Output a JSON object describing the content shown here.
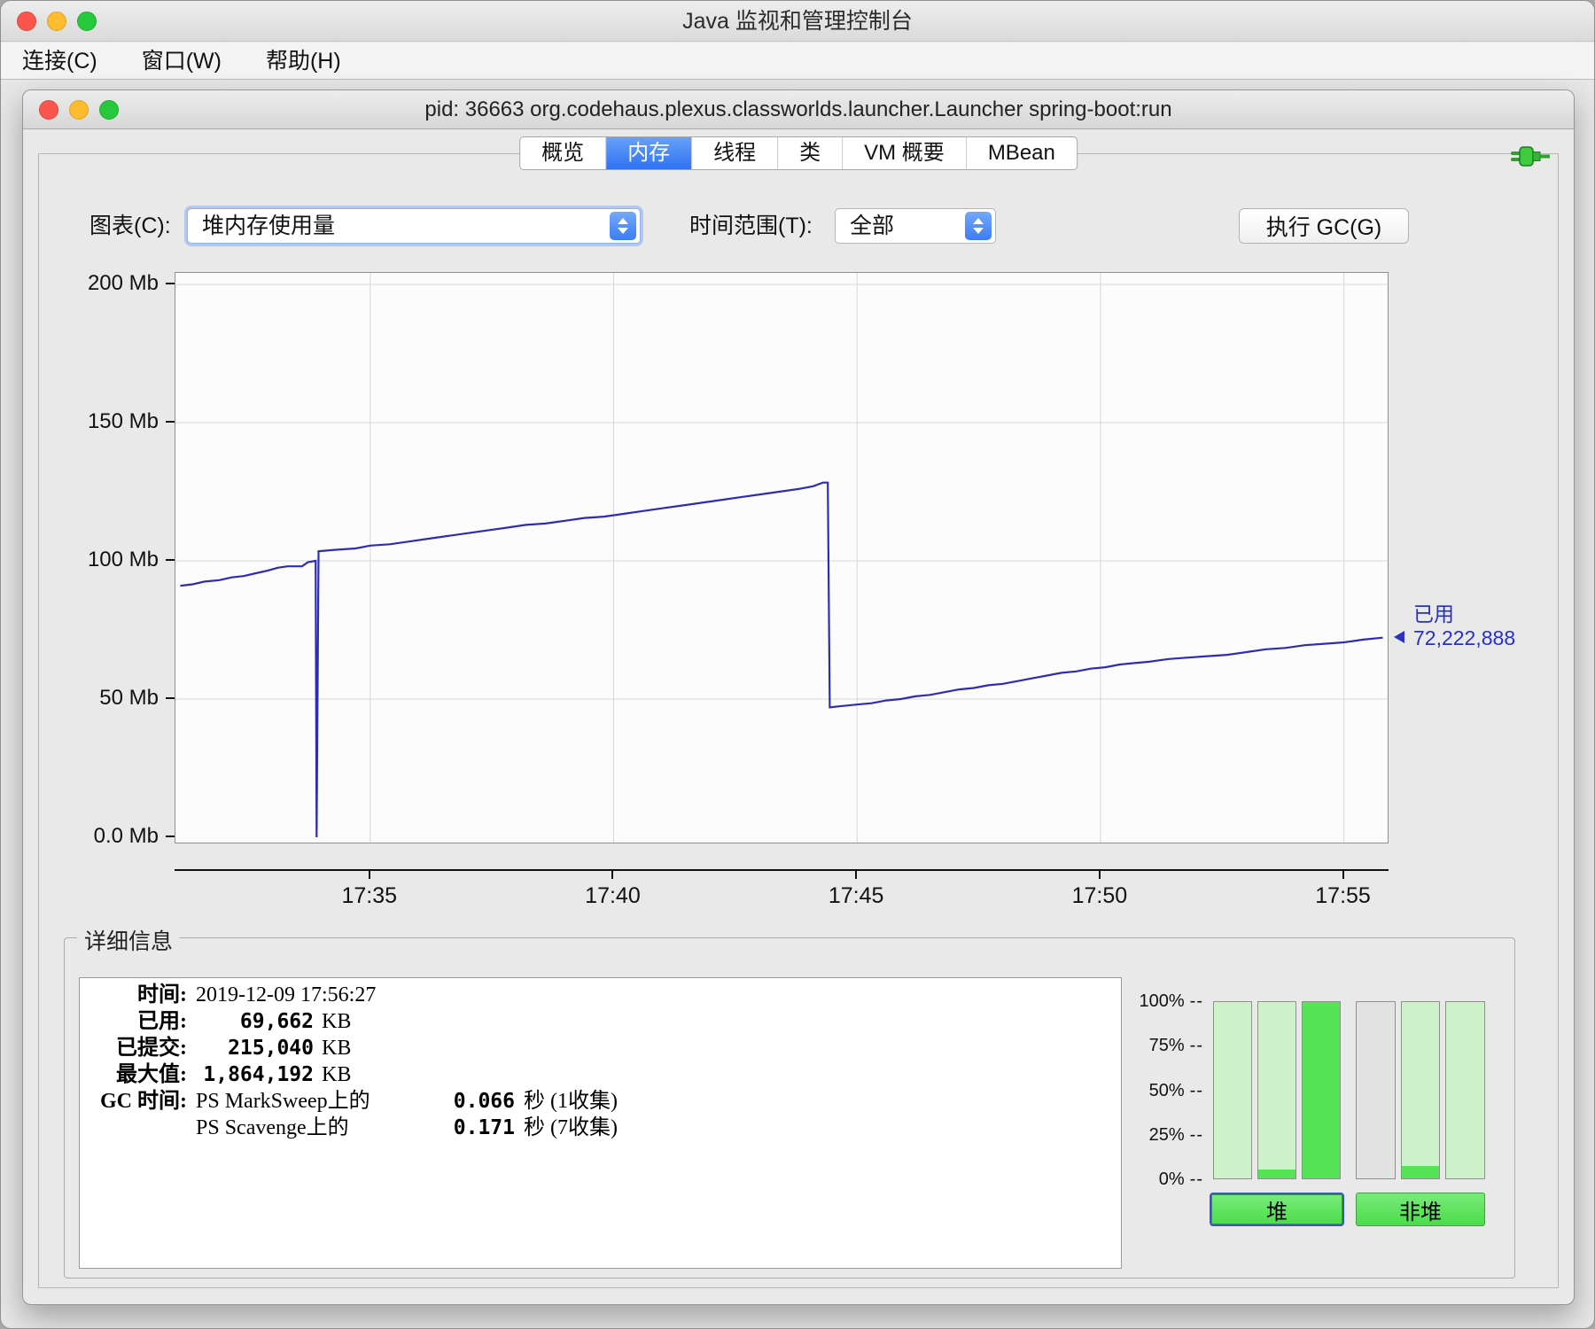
{
  "window": {
    "title": "Java 监视和管理控制台",
    "menu": [
      {
        "label": "连接(C)"
      },
      {
        "label": "窗口(W)"
      },
      {
        "label": "帮助(H)"
      }
    ]
  },
  "inner": {
    "title": "pid: 36663 org.codehaus.plexus.classworlds.launcher.Launcher spring-boot:run",
    "tabs": [
      {
        "label": "概览",
        "selected": false
      },
      {
        "label": "内存",
        "selected": true
      },
      {
        "label": "线程",
        "selected": false
      },
      {
        "label": "类",
        "selected": false
      },
      {
        "label": "VM 概要",
        "selected": false
      },
      {
        "label": "MBean",
        "selected": false
      }
    ]
  },
  "controls": {
    "chart_label": "图表(C):",
    "chart_value": "堆内存使用量",
    "range_label": "时间范围(T):",
    "range_value": "全部",
    "gc_button": "执行 GC(G)"
  },
  "chart_data": {
    "type": "line",
    "title": "堆内存使用量",
    "ylabel": "Mb",
    "ylim": [
      0,
      200
    ],
    "xlim": [
      0,
      24.9
    ],
    "x_unit": "minutes_since_17:31",
    "grid": true,
    "line_color": "#2d2db4",
    "y_ticks": [
      {
        "v": 0,
        "label": "0.0 Mb"
      },
      {
        "v": 50,
        "label": "50 Mb"
      },
      {
        "v": 100,
        "label": "100 Mb"
      },
      {
        "v": 150,
        "label": "150 Mb"
      },
      {
        "v": 200,
        "label": "200 Mb"
      }
    ],
    "x_ticks": [
      {
        "t": 4,
        "label": "17:35"
      },
      {
        "t": 9,
        "label": "17:40"
      },
      {
        "t": 14,
        "label": "17:45"
      },
      {
        "t": 19,
        "label": "17:50"
      },
      {
        "t": 24,
        "label": "17:55"
      }
    ],
    "annotation": {
      "label": "已用",
      "value": "72,222,888",
      "at_mb": 72.2
    },
    "series": [
      {
        "name": "已用堆内存 (Mb)",
        "points": [
          [
            0.1,
            91
          ],
          [
            0.35,
            91.5
          ],
          [
            0.6,
            92.5
          ],
          [
            0.9,
            93
          ],
          [
            1.15,
            94
          ],
          [
            1.4,
            94.5
          ],
          [
            1.65,
            95.5
          ],
          [
            1.9,
            96.5
          ],
          [
            2.1,
            97.5
          ],
          [
            2.3,
            98
          ],
          [
            2.6,
            98
          ],
          [
            2.72,
            99.5
          ],
          [
            2.88,
            100
          ],
          [
            2.9,
            0
          ],
          [
            2.94,
            103.5
          ],
          [
            3.3,
            104
          ],
          [
            3.7,
            104.5
          ],
          [
            4.0,
            105.5
          ],
          [
            4.4,
            106
          ],
          [
            4.8,
            107
          ],
          [
            5.2,
            108
          ],
          [
            5.6,
            109
          ],
          [
            6.0,
            110
          ],
          [
            6.4,
            111
          ],
          [
            6.8,
            112
          ],
          [
            7.2,
            113
          ],
          [
            7.6,
            113.5
          ],
          [
            8.0,
            114.5
          ],
          [
            8.4,
            115.5
          ],
          [
            8.8,
            116
          ],
          [
            9.2,
            117
          ],
          [
            9.6,
            118
          ],
          [
            10.0,
            119
          ],
          [
            10.4,
            120
          ],
          [
            10.8,
            121
          ],
          [
            11.2,
            122
          ],
          [
            11.6,
            123
          ],
          [
            12.0,
            124
          ],
          [
            12.4,
            125
          ],
          [
            12.8,
            126
          ],
          [
            13.1,
            127
          ],
          [
            13.3,
            128.3
          ],
          [
            13.4,
            128.3
          ],
          [
            13.44,
            47
          ],
          [
            13.7,
            47.5
          ],
          [
            14.0,
            48
          ],
          [
            14.3,
            48.5
          ],
          [
            14.6,
            49.5
          ],
          [
            14.9,
            50
          ],
          [
            15.2,
            51
          ],
          [
            15.5,
            51.5
          ],
          [
            15.8,
            52.5
          ],
          [
            16.1,
            53.5
          ],
          [
            16.4,
            54
          ],
          [
            16.7,
            55
          ],
          [
            17.0,
            55.5
          ],
          [
            17.3,
            56.5
          ],
          [
            17.6,
            57.5
          ],
          [
            17.9,
            58.5
          ],
          [
            18.2,
            59.5
          ],
          [
            18.5,
            60
          ],
          [
            18.8,
            61
          ],
          [
            19.1,
            61.5
          ],
          [
            19.4,
            62.5
          ],
          [
            19.7,
            63
          ],
          [
            20.0,
            63.5
          ],
          [
            20.4,
            64.5
          ],
          [
            20.8,
            65
          ],
          [
            21.2,
            65.5
          ],
          [
            21.6,
            66
          ],
          [
            22.0,
            67
          ],
          [
            22.4,
            68
          ],
          [
            22.8,
            68.5
          ],
          [
            23.2,
            69.5
          ],
          [
            23.6,
            70
          ],
          [
            24.0,
            70.5
          ],
          [
            24.4,
            71.5
          ],
          [
            24.8,
            72.2
          ]
        ]
      }
    ]
  },
  "details": {
    "legend": "详细信息",
    "rows": [
      {
        "label": "时间:",
        "value": "2019-12-09 17:56:27"
      },
      {
        "label": "已用:",
        "num": "69,662",
        "unit": "KB"
      },
      {
        "label": "已提交:",
        "num": "215,040",
        "unit": "KB"
      },
      {
        "label": "最大值:",
        "num": "1,864,192",
        "unit": "KB"
      }
    ],
    "gc": {
      "label": "GC 时间:",
      "rows": [
        {
          "name": "PS MarkSweep上的",
          "num": "0.066",
          "rest": "秒 (1收集)"
        },
        {
          "name": "PS Scavenge上的",
          "num": "0.171",
          "rest": "秒 (7收集)"
        }
      ]
    }
  },
  "gauges": {
    "scale": [
      "100%",
      "75%",
      "50%",
      "25%",
      "0%"
    ],
    "dash": "--",
    "heap": {
      "button": "堆",
      "bars": [
        {
          "committed": 100,
          "used": 0
        },
        {
          "committed": 100,
          "used": 5
        },
        {
          "committed": 100,
          "used": 100
        }
      ]
    },
    "nonheap": {
      "button": "非堆",
      "bars": [
        {
          "committed": 0,
          "used": 0
        },
        {
          "committed": 100,
          "used": 7
        },
        {
          "committed": 100,
          "used": 0
        }
      ]
    }
  },
  "colors": {
    "accent_blue": "#3b7bf6",
    "line_blue": "#2d2db4",
    "green_bright": "#55e455",
    "green_pale": "#cdf2ca"
  }
}
